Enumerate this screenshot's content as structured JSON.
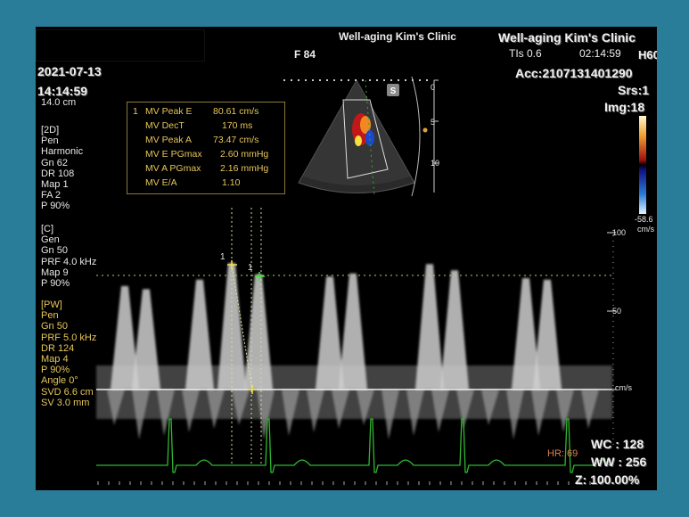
{
  "header": {
    "clinic_top": "Well-aging Kim's Clinic",
    "clinic_right": "Well-aging Kim's Clinic",
    "frame": "F 84",
    "tis": "TIs   0.6",
    "clock": "02:14:59",
    "probe": "H60",
    "acc": "Acc:2107131401290",
    "srs": "Srs:1",
    "img": "Img:18",
    "date": "2021-07-13",
    "time": "14:14:59",
    "depth": "14.0 cm"
  },
  "sector": {
    "marker": "S",
    "d0": "0",
    "d5": "5",
    "d10": "10"
  },
  "colorbar": {
    "value": "-58.6",
    "unit": "cm/s"
  },
  "scale": {
    "l100": "100",
    "l50": "50",
    "unit": "cm/s"
  },
  "calipers": {
    "e": "1",
    "a": "1"
  },
  "params_2d": [
    "[2D]",
    "Pen",
    "Harmonic",
    "Gn  62",
    "DR  108",
    "Map  1",
    "FA  2",
    "P    90%"
  ],
  "params_c": [
    "[C]",
    "Gen",
    "Gn  50",
    "PRF  4.0 kHz",
    "Map  9",
    "P    90%"
  ],
  "params_pw": [
    "[PW]",
    "Pen",
    "Gn  50",
    "PRF  5.0 kHz",
    "DR  124",
    "Map  4",
    "P    90%",
    "Angle  0°",
    "SVD  6.6 cm",
    "SV   3.0 mm"
  ],
  "measurements": {
    "index": "1",
    "rows": [
      {
        "label": "MV Peak E",
        "value": "80.61 cm/s"
      },
      {
        "label": "MV DecT",
        "value": "170 ms"
      },
      {
        "label": "MV Peak A",
        "value": "73.47 cm/s"
      },
      {
        "label": "MV E PGmax",
        "value": "2.60 mmHg"
      },
      {
        "label": "MV A PGmax",
        "value": "2.16 mmHg"
      },
      {
        "label": "MV E/A",
        "value": "1.10"
      }
    ]
  },
  "footer": {
    "hr": "HR: 69",
    "wc": "WC : 128",
    "ww": "WW : 256",
    "zoom": "Z: 100.00%"
  },
  "chart_data": {
    "type": "line",
    "ylabel": "cm/s",
    "ylim": [
      -50,
      100
    ],
    "series": [
      {
        "values": [
          0,
          80.61,
          0,
          73.47,
          0,
          75,
          0,
          78,
          0,
          72,
          0,
          74,
          0,
          80,
          0,
          76,
          0,
          71,
          0,
          70,
          0
        ]
      }
    ]
  }
}
